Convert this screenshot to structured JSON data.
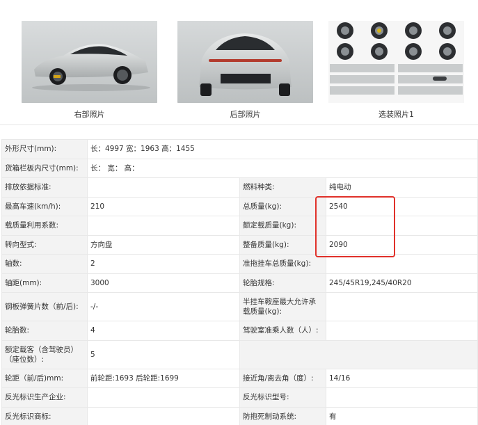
{
  "photos": [
    {
      "caption": "右部照片"
    },
    {
      "caption": "后部照片"
    },
    {
      "caption": "选装照片1"
    }
  ],
  "specs": {
    "r0": {
      "l1": "外形尺寸(mm):",
      "v1": "长：4997 宽：1963 高：1455"
    },
    "r1": {
      "l1": "货箱栏板内尺寸(mm):",
      "v1": "长：  宽：  高："
    },
    "r2": {
      "l1": "排放依据标准:",
      "v1": "",
      "l2": "燃料种类:",
      "v2": "纯电动"
    },
    "r3": {
      "l1": "最高车速(km/h):",
      "v1": "210",
      "l2": "总质量(kg):",
      "v2": "2540"
    },
    "r4": {
      "l1": "载质量利用系数:",
      "v1": "",
      "l2": "额定载质量(kg):",
      "v2": ""
    },
    "r5": {
      "l1": "转向型式:",
      "v1": "方向盘",
      "l2": "整备质量(kg):",
      "v2": "2090"
    },
    "r6": {
      "l1": "轴数:",
      "v1": "2",
      "l2": "准拖挂车总质量(kg):",
      "v2": ""
    },
    "r7": {
      "l1": "轴距(mm):",
      "v1": "3000",
      "l2": "轮胎规格:",
      "v2": "245/45R19,245/40R20"
    },
    "r8": {
      "l1": "钢板弹簧片数（前/后):",
      "v1": "-/-",
      "l2": "半挂车鞍座最大允许承载质量(kg):",
      "v2": ""
    },
    "r9": {
      "l1": "轮胎数:",
      "v1": "4",
      "l2": "驾驶室准乘人数（人）:",
      "v2": ""
    },
    "r10": {
      "l1": "额定载客（含驾驶员）（座位数）:",
      "v1": "5"
    },
    "r11": {
      "l1": "轮距（前/后)mm:",
      "v1": "前轮距:1693 后轮距:1699",
      "l2": "接近角/离去角（度）:",
      "v2": "14/16"
    },
    "r12": {
      "l1": "反光标识生产企业:",
      "v1": "",
      "l2": "反光标识型号:",
      "v2": ""
    },
    "r13": {
      "l1": "反光标识商标:",
      "v1": "",
      "l2": "防抱死制动系统:",
      "v2": "有"
    }
  },
  "colors": {
    "highlight": "#e0312a",
    "label_bg": "#f3f3f3",
    "border": "#e8e8e8"
  }
}
